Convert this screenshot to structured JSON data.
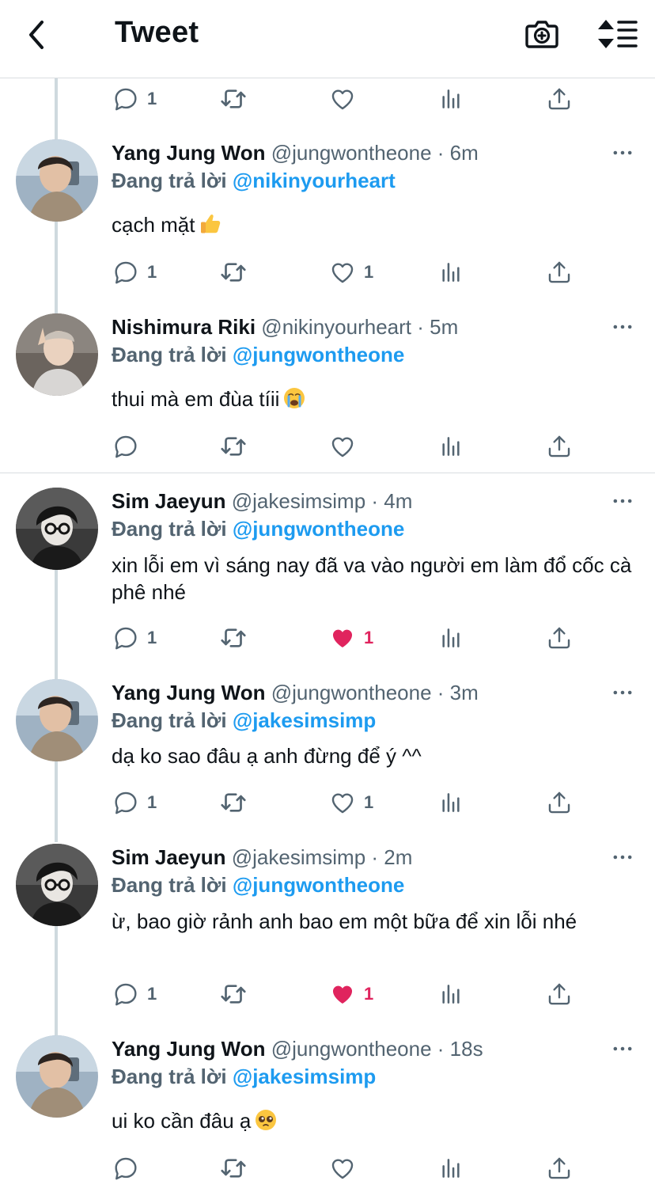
{
  "header": {
    "title": "Tweet",
    "back_icon": "chevron-left-icon",
    "camera_icon": "camera-add-icon",
    "sort_icon": "sort-icon"
  },
  "colors": {
    "link": "#1d9bf0",
    "secondary": "#536471",
    "like_active": "#e0245e",
    "thread_line": "#cfd9de"
  },
  "top_actions": {
    "reply_count": "1"
  },
  "tweets": [
    {
      "name": "Yang Jung Won",
      "handle": "@jungwontheone",
      "time": "· 6m",
      "reply_prefix": "Đang trả lời",
      "reply_to": "@nikinyourheart",
      "text": "cạch mặt",
      "emoji": "thumbs-up-emoji",
      "reply_count": "1",
      "like_count": "1",
      "liked": false
    },
    {
      "name": "Nishimura Riki",
      "handle": "@nikinyourheart",
      "time": "· 5m",
      "reply_prefix": "Đang trả lời",
      "reply_to": "@jungwontheone",
      "text": "thui mà em đùa tíii",
      "emoji": "crying-face-emoji",
      "reply_count": "",
      "like_count": "",
      "liked": false
    },
    {
      "name": "Sim Jaeyun",
      "handle": "@jakesimsimp",
      "time": "· 4m",
      "reply_prefix": "Đang trả lời",
      "reply_to": "@jungwontheone",
      "text": "xin lỗi em vì sáng nay đã va vào người em làm đổ cốc cà phê nhé",
      "reply_count": "1",
      "like_count": "1",
      "liked": true
    },
    {
      "name": "Yang Jung Won",
      "handle": "@jungwontheone",
      "time": "· 3m",
      "reply_prefix": "Đang trả lời",
      "reply_to": "@jakesimsimp",
      "text": "dạ ko sao đâu ạ anh đừng để ý ^^",
      "reply_count": "1",
      "like_count": "1",
      "liked": false
    },
    {
      "name": "Sim Jaeyun",
      "handle": "@jakesimsimp",
      "time": "· 2m",
      "reply_prefix": "Đang trả lời",
      "reply_to": "@jungwontheone",
      "text": "ừ, bao giờ rảnh anh bao em một bữa để xin lỗi nhé",
      "reply_count": "1",
      "like_count": "1",
      "liked": true
    },
    {
      "name": "Yang Jung Won",
      "handle": "@jungwontheone",
      "time": "· 18s",
      "reply_prefix": "Đang trả lời",
      "reply_to": "@jakesimsimp",
      "text": "ui ko cần đâu ạ",
      "emoji": "pleading-face-emoji",
      "reply_count": "",
      "like_count": "",
      "liked": false
    }
  ]
}
